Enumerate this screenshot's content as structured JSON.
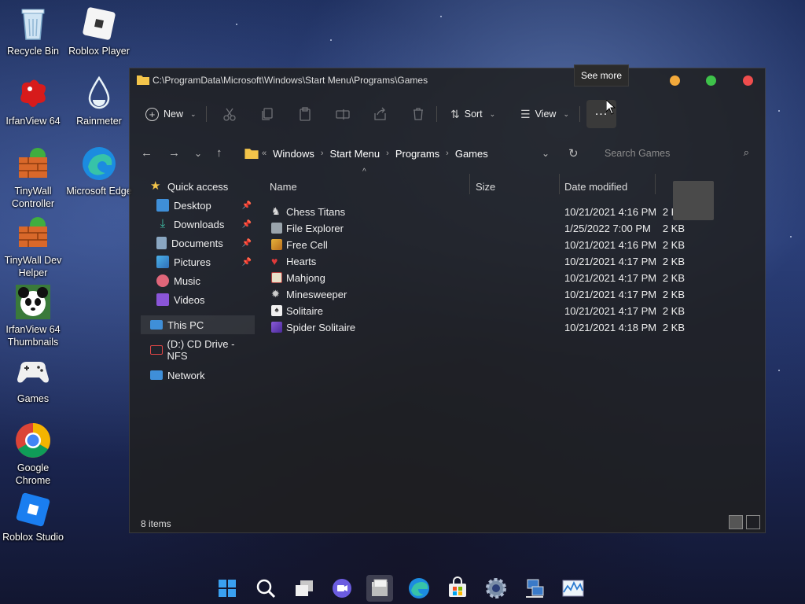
{
  "desktop": {
    "icons": [
      {
        "label": "Recycle Bin",
        "icon": "recycle-bin-icon"
      },
      {
        "label": "Roblox Player",
        "icon": "roblox-player-icon"
      },
      {
        "label": "IrfanView 64",
        "icon": "irfanview-icon"
      },
      {
        "label": "Rainmeter",
        "icon": "rainmeter-icon"
      },
      {
        "label": "TinyWall Controller",
        "icon": "tinywall-icon"
      },
      {
        "label": "Microsoft Edge",
        "icon": "edge-icon"
      },
      {
        "label": "TinyWall Dev Helper",
        "icon": "tinywall-dev-icon"
      },
      {
        "label": "IrfanView 64 Thumbnails",
        "icon": "irfanview-thumbnails-icon"
      },
      {
        "label": "Games",
        "icon": "gamepad-icon"
      },
      {
        "label": "Google Chrome",
        "icon": "chrome-icon"
      },
      {
        "label": "Roblox Studio",
        "icon": "roblox-studio-icon"
      }
    ]
  },
  "window": {
    "title": "C:\\ProgramData\\Microsoft\\Windows\\Start Menu\\Programs\\Games",
    "tooltip": "See more",
    "controls": {
      "minimize": "#f2a93b",
      "maximize": "#3ec24a",
      "close": "#ef4d4d"
    }
  },
  "commandbar": {
    "new_label": "New",
    "sort_label": "Sort",
    "view_label": "View",
    "more_label": "..."
  },
  "address": {
    "crumbs": [
      "Windows",
      "Start Menu",
      "Programs",
      "Games"
    ],
    "search_placeholder": "Search Games"
  },
  "sidebar": {
    "items": [
      {
        "label": "Quick access",
        "icon": "star-icon"
      },
      {
        "label": "Desktop",
        "icon": "desktop-icon"
      },
      {
        "label": "Downloads",
        "icon": "download-icon"
      },
      {
        "label": "Documents",
        "icon": "document-icon"
      },
      {
        "label": "Pictures",
        "icon": "picture-icon"
      },
      {
        "label": "Music",
        "icon": "music-icon"
      },
      {
        "label": "Videos",
        "icon": "video-icon"
      },
      {
        "label": "This PC",
        "icon": "pc-icon"
      },
      {
        "label": "(D:) CD Drive - NFS",
        "icon": "cd-drive-icon"
      },
      {
        "label": "Network",
        "icon": "network-icon"
      }
    ]
  },
  "filelist": {
    "headers": {
      "name": "Name",
      "size": "Size",
      "date": "Date modified"
    },
    "rows": [
      {
        "name": "Chess Titans",
        "size": "2 KB",
        "date": "10/21/2021 4:16 PM"
      },
      {
        "name": "File Explorer",
        "size": "2 KB",
        "date": "1/25/2022 7:00 PM"
      },
      {
        "name": "Free Cell",
        "size": "2 KB",
        "date": "10/21/2021 4:16 PM"
      },
      {
        "name": "Hearts",
        "size": "2 KB",
        "date": "10/21/2021 4:17 PM"
      },
      {
        "name": "Mahjong",
        "size": "2 KB",
        "date": "10/21/2021 4:17 PM"
      },
      {
        "name": "Minesweeper",
        "size": "2 KB",
        "date": "10/21/2021 4:17 PM"
      },
      {
        "name": "Solitaire",
        "size": "2 KB",
        "date": "10/21/2021 4:17 PM"
      },
      {
        "name": "Spider Solitaire",
        "size": "2 KB",
        "date": "10/21/2021 4:18 PM"
      }
    ]
  },
  "status": {
    "item_count": "8 items"
  },
  "taskbar": {
    "apps": [
      "start-icon",
      "search-icon",
      "task-view-icon",
      "chat-icon",
      "file-explorer-icon",
      "edge-icon",
      "store-icon",
      "settings-icon",
      "network-manager-icon",
      "performance-monitor-icon"
    ]
  }
}
